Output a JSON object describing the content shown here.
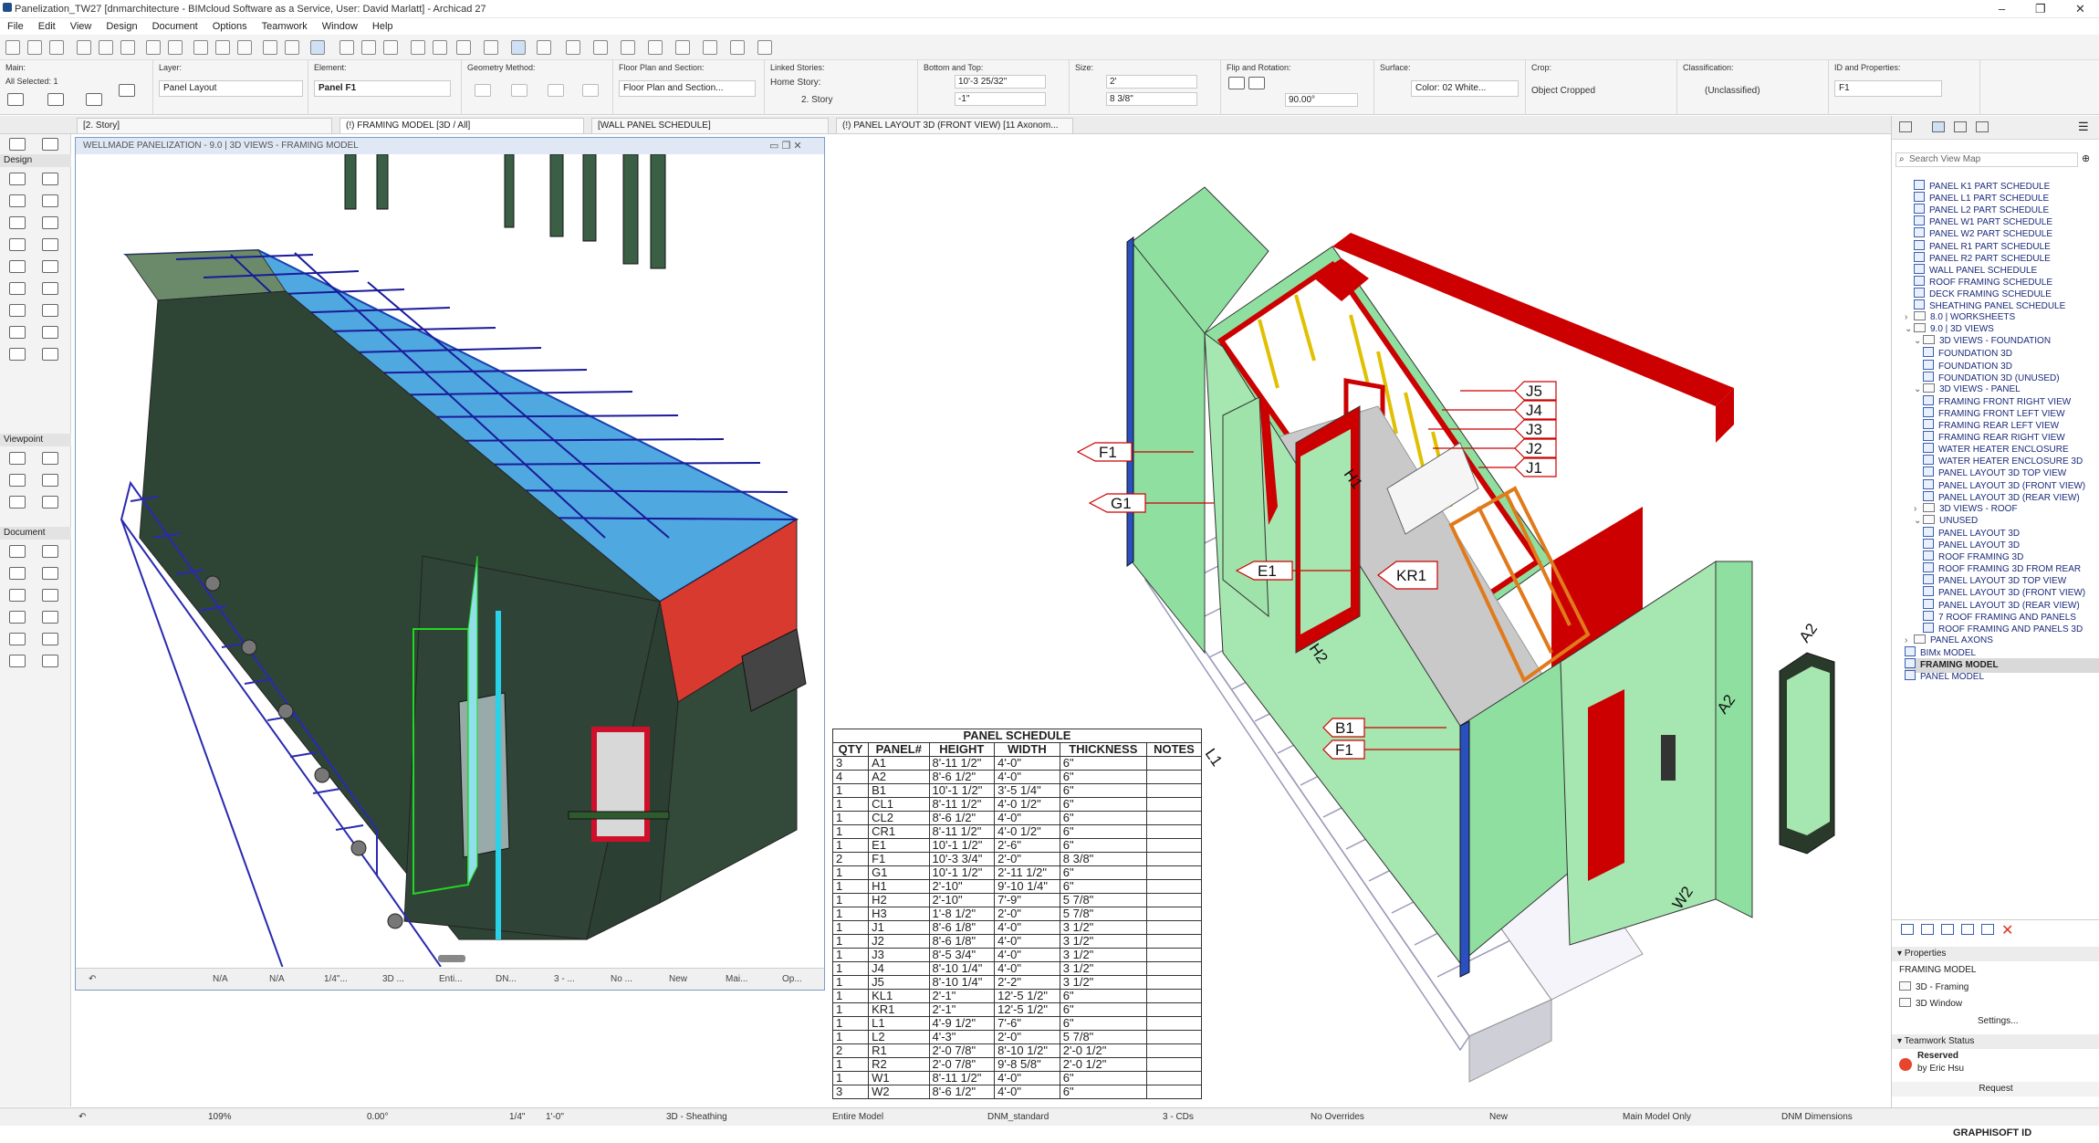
{
  "titlebar": {
    "title": "Panelization_TW27 [dnmarchitecture - BIMcloud Software as a Service, User: David Marlatt] - Archicad 27"
  },
  "menu": [
    "File",
    "Edit",
    "View",
    "Design",
    "Document",
    "Options",
    "Teamwork",
    "Window",
    "Help"
  ],
  "infobox": {
    "main_label": "Main:",
    "all_selected": "All Selected: 1",
    "layer_label": "Layer:",
    "layer_value": "Panel Layout",
    "element_label": "Element:",
    "element_value": "Panel F1",
    "geometry_label": "Geometry Method:",
    "floorplan_label": "Floor Plan and Section:",
    "floorplan_value": "Floor Plan and Section...",
    "linked_label": "Linked Stories:",
    "home_story_label": "Home Story:",
    "home_story_value": "2. Story",
    "bottomtop_label": "Bottom and Top:",
    "top_value": "10'-3 25/32\"",
    "bottom_value": "-1\"",
    "size_label": "Size:",
    "size1": "2'",
    "size2": "8 3/8\"",
    "flip_label": "Flip and Rotation:",
    "rotation": "90.00°",
    "surface_label": "Surface:",
    "surface_value": "Color: 02 White...",
    "crop_label": "Crop:",
    "crop_value": "Object Cropped",
    "class_label": "Classification:",
    "class_value": "(Unclassified)",
    "id_label": "ID and Properties:",
    "id_value": "F1"
  },
  "tabs": [
    "[2. Story]",
    "(!) FRAMING MODEL [3D / All]",
    "[WALL PANEL SCHEDULE]",
    "(!) PANEL LAYOUT 3D (FRONT VIEW) [11 Axonom..."
  ],
  "toolbox": {
    "design": "Design",
    "viewpoint": "Viewpoint",
    "document": "Document"
  },
  "window1": {
    "title": "WELLMADE PANELIZATION - 9.0 | 3D VIEWS - FRAMING MODEL",
    "status": [
      "N/A",
      "N/A",
      "1/4\"...",
      "3D ...",
      "Enti...",
      "DN...",
      "3 - ...",
      "No ...",
      "New",
      "Mai...",
      "Op..."
    ]
  },
  "schedule": {
    "title": "PANEL SCHEDULE",
    "headers": [
      "QTY",
      "PANEL#",
      "HEIGHT",
      "WIDTH",
      "THICKNESS",
      "NOTES"
    ],
    "rows": [
      [
        "3",
        "A1",
        "8'-11 1/2\"",
        "4'-0\"",
        "6\"",
        ""
      ],
      [
        "4",
        "A2",
        "8'-6 1/2\"",
        "4'-0\"",
        "6\"",
        ""
      ],
      [
        "1",
        "B1",
        "10'-1 1/2\"",
        "3'-5 1/4\"",
        "6\"",
        ""
      ],
      [
        "1",
        "CL1",
        "8'-11 1/2\"",
        "4'-0 1/2\"",
        "6\"",
        ""
      ],
      [
        "1",
        "CL2",
        "8'-6 1/2\"",
        "4'-0\"",
        "6\"",
        ""
      ],
      [
        "1",
        "CR1",
        "8'-11 1/2\"",
        "4'-0 1/2\"",
        "6\"",
        ""
      ],
      [
        "1",
        "E1",
        "10'-1 1/2\"",
        "2'-6\"",
        "6\"",
        ""
      ],
      [
        "2",
        "F1",
        "10'-3 3/4\"",
        "2'-0\"",
        "8 3/8\"",
        ""
      ],
      [
        "1",
        "G1",
        "10'-1 1/2\"",
        "2'-11 1/2\"",
        "6\"",
        ""
      ],
      [
        "1",
        "H1",
        "2'-10\"",
        "9'-10 1/4\"",
        "6\"",
        ""
      ],
      [
        "1",
        "H2",
        "2'-10\"",
        "7'-9\"",
        "5 7/8\"",
        ""
      ],
      [
        "1",
        "H3",
        "1'-8 1/2\"",
        "2'-0\"",
        "5 7/8\"",
        ""
      ],
      [
        "1",
        "J1",
        "8'-6 1/8\"",
        "4'-0\"",
        "3 1/2\"",
        ""
      ],
      [
        "1",
        "J2",
        "8'-6 1/8\"",
        "4'-0\"",
        "3 1/2\"",
        ""
      ],
      [
        "1",
        "J3",
        "8'-5 3/4\"",
        "4'-0\"",
        "3 1/2\"",
        ""
      ],
      [
        "1",
        "J4",
        "8'-10 1/4\"",
        "4'-0\"",
        "3 1/2\"",
        ""
      ],
      [
        "1",
        "J5",
        "8'-10 1/4\"",
        "2'-2\"",
        "3 1/2\"",
        ""
      ],
      [
        "1",
        "KL1",
        "2'-1\"",
        "12'-5 1/2\"",
        "6\"",
        ""
      ],
      [
        "1",
        "KR1",
        "2'-1\"",
        "12'-5 1/2\"",
        "6\"",
        ""
      ],
      [
        "1",
        "L1",
        "4'-9 1/2\"",
        "7'-6\"",
        "6\"",
        ""
      ],
      [
        "1",
        "L2",
        "4'-3\"",
        "2'-0\"",
        "5 7/8\"",
        ""
      ],
      [
        "2",
        "R1",
        "2'-0 7/8\"",
        "8'-10 1/2\"",
        "2'-0 1/2\"",
        ""
      ],
      [
        "1",
        "R2",
        "2'-0 7/8\"",
        "9'-8 5/8\"",
        "2'-0 1/2\"",
        ""
      ],
      [
        "1",
        "W1",
        "8'-11 1/2\"",
        "4'-0\"",
        "6\"",
        ""
      ],
      [
        "3",
        "W2",
        "8'-6 1/2\"",
        "4'-0\"",
        "6\"",
        ""
      ]
    ]
  },
  "callouts": {
    "F1": "F1",
    "G1": "G1",
    "H1": "H1",
    "E1": "E1",
    "H2": "H2",
    "KR1": "KR1",
    "L1": "L1",
    "A2": "A2",
    "A2b": "A2",
    "W2": "W2",
    "B1": "B1",
    "F1b": "F1",
    "J1": "J1",
    "J2": "J2",
    "J3": "J3",
    "J4": "J4",
    "J5": "J5"
  },
  "navigator": {
    "search_placeholder": "Search View Map",
    "items": [
      {
        "label": "PANEL K1 PART SCHEDULE",
        "indent": 2,
        "kind": "view"
      },
      {
        "label": "PANEL L1 PART SCHEDULE",
        "indent": 2,
        "kind": "view"
      },
      {
        "label": "PANEL L2 PART SCHEDULE",
        "indent": 2,
        "kind": "view"
      },
      {
        "label": "PANEL W1 PART SCHEDULE",
        "indent": 2,
        "kind": "view"
      },
      {
        "label": "PANEL W2 PART SCHEDULE",
        "indent": 2,
        "kind": "view"
      },
      {
        "label": "PANEL R1 PART SCHEDULE",
        "indent": 2,
        "kind": "view"
      },
      {
        "label": "PANEL R2 PART SCHEDULE",
        "indent": 2,
        "kind": "view"
      },
      {
        "label": "WALL PANEL SCHEDULE",
        "indent": 2,
        "kind": "view"
      },
      {
        "label": "ROOF FRAMING SCHEDULE",
        "indent": 2,
        "kind": "view"
      },
      {
        "label": "DECK FRAMING SCHEDULE",
        "indent": 2,
        "kind": "view"
      },
      {
        "label": "SHEATHING PANEL SCHEDULE",
        "indent": 2,
        "kind": "view"
      },
      {
        "label": "8.0 | WORKSHEETS",
        "indent": 1,
        "kind": "folder",
        "chev": "›"
      },
      {
        "label": "9.0 | 3D VIEWS",
        "indent": 1,
        "kind": "folder",
        "chev": "⌄"
      },
      {
        "label": "3D VIEWS - FOUNDATION",
        "indent": 2,
        "kind": "folder",
        "chev": "⌄"
      },
      {
        "label": "FOUNDATION 3D",
        "indent": 3,
        "kind": "view"
      },
      {
        "label": "FOUNDATION 3D",
        "indent": 3,
        "kind": "view"
      },
      {
        "label": "FOUNDATION 3D (UNUSED)",
        "indent": 3,
        "kind": "view"
      },
      {
        "label": "3D VIEWS - PANEL",
        "indent": 2,
        "kind": "folder",
        "chev": "⌄"
      },
      {
        "label": "FRAMING FRONT RIGHT VIEW",
        "indent": 3,
        "kind": "view"
      },
      {
        "label": "FRAMING FRONT LEFT VIEW",
        "indent": 3,
        "kind": "view"
      },
      {
        "label": "FRAMING REAR LEFT VIEW",
        "indent": 3,
        "kind": "view"
      },
      {
        "label": "FRAMING REAR RIGHT VIEW",
        "indent": 3,
        "kind": "view"
      },
      {
        "label": "WATER HEATER ENCLOSURE",
        "indent": 3,
        "kind": "view"
      },
      {
        "label": "WATER HEATER ENCLOSURE 3D",
        "indent": 3,
        "kind": "view"
      },
      {
        "label": "PANEL LAYOUT 3D TOP VIEW",
        "indent": 3,
        "kind": "view"
      },
      {
        "label": "PANEL LAYOUT 3D (FRONT VIEW)",
        "indent": 3,
        "kind": "view"
      },
      {
        "label": "PANEL LAYOUT 3D (REAR VIEW)",
        "indent": 3,
        "kind": "view"
      },
      {
        "label": "3D VIEWS - ROOF",
        "indent": 2,
        "kind": "folder",
        "chev": "›"
      },
      {
        "label": "UNUSED",
        "indent": 2,
        "kind": "folder",
        "chev": "⌄"
      },
      {
        "label": "PANEL LAYOUT 3D",
        "indent": 3,
        "kind": "view"
      },
      {
        "label": "PANEL LAYOUT 3D",
        "indent": 3,
        "kind": "view"
      },
      {
        "label": "ROOF FRAMING 3D",
        "indent": 3,
        "kind": "view"
      },
      {
        "label": "ROOF FRAMING 3D FROM REAR",
        "indent": 3,
        "kind": "view"
      },
      {
        "label": "PANEL LAYOUT 3D TOP VIEW",
        "indent": 3,
        "kind": "view"
      },
      {
        "label": "PANEL LAYOUT 3D (FRONT VIEW)",
        "indent": 3,
        "kind": "view"
      },
      {
        "label": "PANEL LAYOUT 3D (REAR VIEW)",
        "indent": 3,
        "kind": "view"
      },
      {
        "label": "7 ROOF FRAMING AND PANELS",
        "indent": 3,
        "kind": "view"
      },
      {
        "label": "ROOF FRAMING AND PANELS 3D",
        "indent": 3,
        "kind": "view"
      },
      {
        "label": "PANEL AXONS",
        "indent": 1,
        "kind": "folder",
        "chev": "›"
      },
      {
        "label": "BIMx MODEL",
        "indent": 1,
        "kind": "view"
      },
      {
        "label": "FRAMING MODEL",
        "indent": 1,
        "kind": "view",
        "selected": true
      },
      {
        "label": "PANEL MODEL",
        "indent": 1,
        "kind": "view"
      }
    ]
  },
  "properties": {
    "header": "Properties",
    "name": "FRAMING MODEL",
    "view": "3D - Framing",
    "window": "3D Window",
    "settings": "Settings..."
  },
  "teamwork": {
    "header": "Teamwork Status",
    "state": "Reserved",
    "by": "by Eric Hsu",
    "request": "Request"
  },
  "statusbar": [
    "109%",
    "0.00°",
    "1/4\"",
    "1'-0\"",
    "3D - Sheathing",
    "Entire Model",
    "DNM_standard",
    "3 - CDs",
    "No Overrides",
    "New",
    "Main Model Only",
    "DNM Dimensions"
  ],
  "brand": "GRAPHISOFT ID"
}
